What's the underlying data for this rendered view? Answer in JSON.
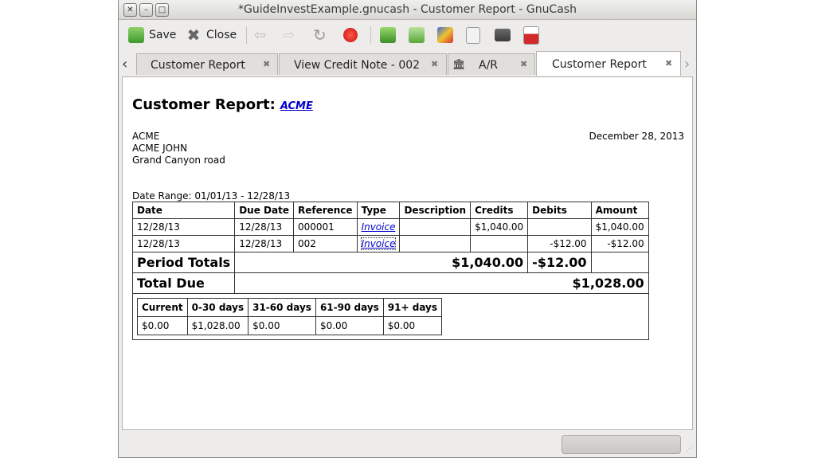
{
  "window": {
    "title": "*GuideInvestExample.gnucash - Customer Report - GnuCash",
    "controls": [
      "✕",
      "–",
      "□"
    ]
  },
  "toolbar": {
    "save_label": "Save",
    "close_label": "Close"
  },
  "tabs": [
    {
      "label": "Customer Report",
      "close": "✖"
    },
    {
      "label": "View Credit Note - 002",
      "close": "✖"
    },
    {
      "label": "A/R",
      "close": "✖"
    },
    {
      "label": "Customer Report",
      "close": "✖"
    }
  ],
  "nav": {
    "left": "‹",
    "right": "›"
  },
  "report": {
    "title": "Customer Report:",
    "customer_link": "ACME",
    "address": [
      "ACME",
      "ACME JOHN",
      "Grand Canyon road"
    ],
    "date": "December 28, 2013",
    "date_range": "Date Range: 01/01/13 - 12/28/13",
    "columns": [
      "Date",
      "Due Date",
      "Reference",
      "Type",
      "Description",
      "Credits",
      "Debits",
      "Amount"
    ],
    "rows": [
      {
        "date": "12/28/13",
        "due": "12/28/13",
        "ref": "000001",
        "type": "Invoice",
        "desc": "",
        "credits": "$1,040.00",
        "debits": "",
        "amount": "$1,040.00"
      },
      {
        "date": "12/28/13",
        "due": "12/28/13",
        "ref": "002",
        "type": "Invoice",
        "desc": "",
        "credits": "",
        "debits": "-$12.00",
        "amount": "-$12.00"
      }
    ],
    "period_totals": {
      "label": "Period Totals",
      "credits": "$1,040.00",
      "debits": "-$12.00"
    },
    "total_due": {
      "label": "Total Due",
      "amount": "$1,028.00"
    },
    "aging": {
      "headers": [
        "Current",
        "0-30 days",
        "31-60 days",
        "61-90 days",
        "91+ days"
      ],
      "values": [
        "$0.00",
        "$1,028.00",
        "$0.00",
        "$0.00",
        "$0.00"
      ]
    }
  }
}
